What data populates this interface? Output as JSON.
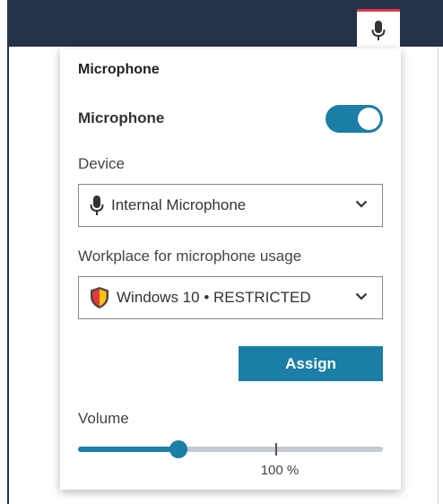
{
  "header": {
    "mic_button_icon": "microphone-icon",
    "accent_color": "#d9384f"
  },
  "panel": {
    "title": "Microphone",
    "toggle": {
      "label": "Microphone",
      "on": true,
      "color": "#1b7ea6"
    },
    "device": {
      "label": "Device",
      "selected": "Internal Microphone",
      "icon": "microphone-icon"
    },
    "workplace": {
      "label": "Workplace for microphone usage",
      "selected": "Windows 10 • RESTRICTED",
      "icon": "shield-icon"
    },
    "assign_label": "Assign",
    "volume": {
      "label": "Volume",
      "level_fraction": 0.33,
      "tick_fraction": 0.65,
      "tick_label": "100 %"
    }
  }
}
